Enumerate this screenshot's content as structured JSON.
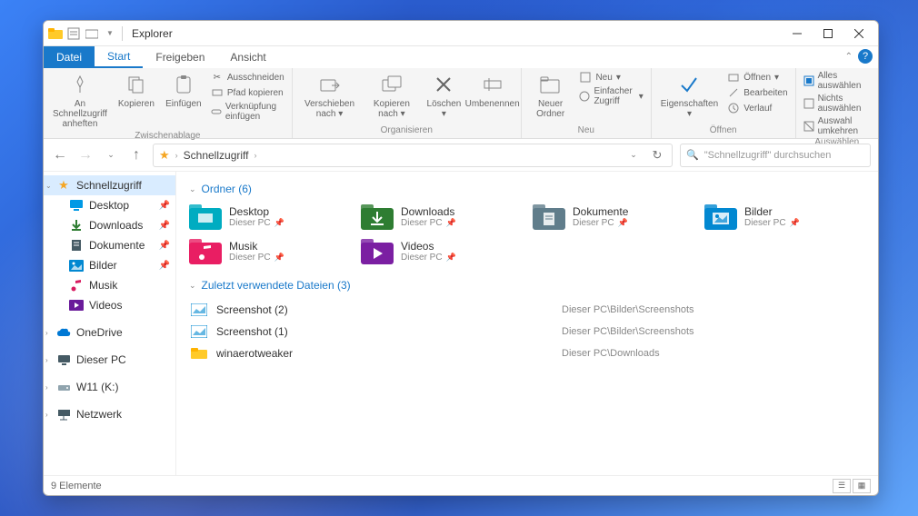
{
  "window": {
    "title": "Explorer"
  },
  "tabs": {
    "file": "Datei",
    "items": [
      "Start",
      "Freigeben",
      "Ansicht"
    ],
    "active": 0
  },
  "ribbon": {
    "clipboard": {
      "label": "Zwischenablage",
      "pin": "An Schnellzugriff anheften",
      "copy": "Kopieren",
      "paste": "Einfügen",
      "cut": "Ausschneiden",
      "copy_path": "Pfad kopieren",
      "paste_link": "Verknüpfung einfügen"
    },
    "organize": {
      "label": "Organisieren",
      "move": "Verschieben nach",
      "copy_to": "Kopieren nach",
      "delete": "Löschen",
      "rename": "Umbenennen"
    },
    "new": {
      "label": "Neu",
      "new_folder": "Neuer Ordner",
      "new_item": "Neu",
      "easy_access": "Einfacher Zugriff"
    },
    "open": {
      "label": "Öffnen",
      "properties": "Eigenschaften",
      "open": "Öffnen",
      "edit": "Bearbeiten",
      "history": "Verlauf"
    },
    "select": {
      "label": "Auswählen",
      "all": "Alles auswählen",
      "none": "Nichts auswählen",
      "invert": "Auswahl umkehren"
    }
  },
  "nav": {
    "breadcrumb": [
      "Schnellzugriff"
    ],
    "search_placeholder": "\"Schnellzugriff\" durchsuchen"
  },
  "sidebar": {
    "quick": {
      "label": "Schnellzugriff",
      "items": [
        {
          "label": "Desktop",
          "icon": "desktop",
          "color": "#0099e5",
          "pinned": true
        },
        {
          "label": "Downloads",
          "icon": "download",
          "color": "#2e7d32",
          "pinned": true
        },
        {
          "label": "Dokumente",
          "icon": "document",
          "color": "#455a64",
          "pinned": true
        },
        {
          "label": "Bilder",
          "icon": "image",
          "color": "#0288d1",
          "pinned": true
        },
        {
          "label": "Musik",
          "icon": "music",
          "color": "#d81b60",
          "pinned": false
        },
        {
          "label": "Videos",
          "icon": "video",
          "color": "#6a1b9a",
          "pinned": false
        }
      ]
    },
    "root": [
      {
        "label": "OneDrive",
        "icon": "cloud",
        "color": "#0078d4"
      },
      {
        "label": "Dieser PC",
        "icon": "pc",
        "color": "#455a64"
      },
      {
        "label": "W11 (K:)",
        "icon": "drive",
        "color": "#90a4ae"
      },
      {
        "label": "Netzwerk",
        "icon": "network",
        "color": "#455a64"
      }
    ]
  },
  "content": {
    "folders_header": "Ordner (6)",
    "folders": [
      {
        "name": "Desktop",
        "loc": "Dieser PC",
        "color": "#00acc1",
        "icon": "desktop"
      },
      {
        "name": "Downloads",
        "loc": "Dieser PC",
        "color": "#2e7d32",
        "icon": "download"
      },
      {
        "name": "Dokumente",
        "loc": "Dieser PC",
        "color": "#607d8b",
        "icon": "document"
      },
      {
        "name": "Bilder",
        "loc": "Dieser PC",
        "color": "#0288d1",
        "icon": "image"
      },
      {
        "name": "Musik",
        "loc": "Dieser PC",
        "color": "#e91e63",
        "icon": "music"
      },
      {
        "name": "Videos",
        "loc": "Dieser PC",
        "color": "#7b1fa2",
        "icon": "video"
      }
    ],
    "recent_header": "Zuletzt verwendete Dateien (3)",
    "recent": [
      {
        "name": "Screenshot (2)",
        "path": "Dieser PC\\Bilder\\Screenshots",
        "icon": "image-file"
      },
      {
        "name": "Screenshot (1)",
        "path": "Dieser PC\\Bilder\\Screenshots",
        "icon": "image-file"
      },
      {
        "name": "winaerotweaker",
        "path": "Dieser PC\\Downloads",
        "icon": "folder"
      }
    ]
  },
  "status": {
    "text": "9 Elemente"
  }
}
